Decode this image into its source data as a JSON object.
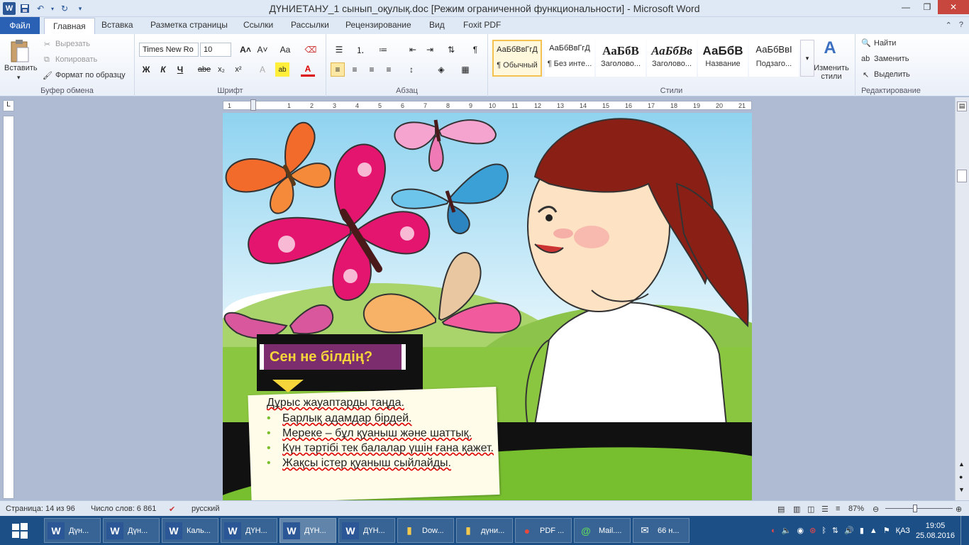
{
  "window": {
    "title": "ДҮНИЕТАНУ_1 сынып_оқулық.doc [Режим ограниченной функциональности]  -  Microsoft Word",
    "app_icon": "W"
  },
  "quick_access": [
    "save-icon",
    "undo-icon",
    "redo-icon",
    "customize-icon"
  ],
  "tabs": {
    "file": "Файл",
    "items": [
      "Главная",
      "Вставка",
      "Разметка страницы",
      "Ссылки",
      "Рассылки",
      "Рецензирование",
      "Вид",
      "Foxit PDF"
    ]
  },
  "ribbon": {
    "clipboard": {
      "label": "Буфер обмена",
      "paste": "Вставить",
      "cut": "Вырезать",
      "copy": "Копировать",
      "format_painter": "Формат по образцу"
    },
    "font": {
      "label": "Шрифт",
      "name": "Times New Ro",
      "size": "10",
      "bold": "Ж",
      "italic": "К",
      "underline": "Ч",
      "strike": "abe",
      "subscript": "x₂",
      "superscript": "x²",
      "grow": "A˄",
      "shrink": "A˅",
      "case": "Aa",
      "highlight": "ab",
      "font_color": "A"
    },
    "paragraph": {
      "label": "Абзац",
      "show_marks": "¶"
    },
    "styles": {
      "label": "Стили",
      "items": [
        {
          "sample": "АаБбВвГгД",
          "name": "¶ Обычный"
        },
        {
          "sample": "АаБбВвГгД",
          "name": "¶ Без инте..."
        },
        {
          "sample": "АаБбВ",
          "name": "Заголово..."
        },
        {
          "sample": "АаБбВв",
          "name": "Заголово..."
        },
        {
          "sample": "АаБбВ",
          "name": "Название"
        },
        {
          "sample": "АаБбВвI",
          "name": "Подзаго..."
        }
      ],
      "change": "Изменить стили"
    },
    "editing": {
      "label": "Редактирование",
      "find": "Найти",
      "replace": "Заменить",
      "select": "Выделить"
    }
  },
  "ruler": {
    "ticks": [
      "1",
      "1",
      "2",
      "3",
      "4",
      "5",
      "6",
      "7",
      "8",
      "9",
      "10",
      "11",
      "12",
      "13",
      "14",
      "15",
      "16",
      "17",
      "18",
      "19",
      "20",
      "21"
    ]
  },
  "document": {
    "question_title": "Сен не білдің?",
    "intro": "Дұрыс жауаптарды таңда.",
    "answers": [
      "Барлық адамдар бірдей.",
      "Мереке – бұл қуаныш және шаттық.",
      "Күн тәртібі тек балалар үшін ғана қажет.",
      "Жақсы істер қуаныш сыйлайды."
    ]
  },
  "statusbar": {
    "page": "Страница: 14 из 96",
    "words": "Число слов: 6 861",
    "language": "русский",
    "zoom": "87%"
  },
  "taskbar": {
    "items": [
      {
        "icon": "W",
        "label": "Дүн..."
      },
      {
        "icon": "W",
        "label": "Дүн..."
      },
      {
        "icon": "W",
        "label": "Каль..."
      },
      {
        "icon": "W",
        "label": "ДҮН..."
      },
      {
        "icon": "W",
        "label": "ДҮН..."
      },
      {
        "icon": "W",
        "label": "ДҮН..."
      },
      {
        "icon": "▮",
        "label": "Dow..."
      },
      {
        "icon": "▮",
        "label": "дүни..."
      },
      {
        "icon": "●",
        "label": "PDF ..."
      },
      {
        "icon": "@",
        "label": "Mail...."
      },
      {
        "icon": "✉",
        "label": "66 н..."
      }
    ],
    "lang": "ҚАЗ",
    "time": "19:05",
    "date": "25.08.2016"
  },
  "colors": {
    "accent": "#2b5797",
    "question_bg": "#7b2d6e",
    "question_text": "#f6d53b",
    "bullet": "#7bbf2e",
    "taskbar": "#1c4f86"
  }
}
